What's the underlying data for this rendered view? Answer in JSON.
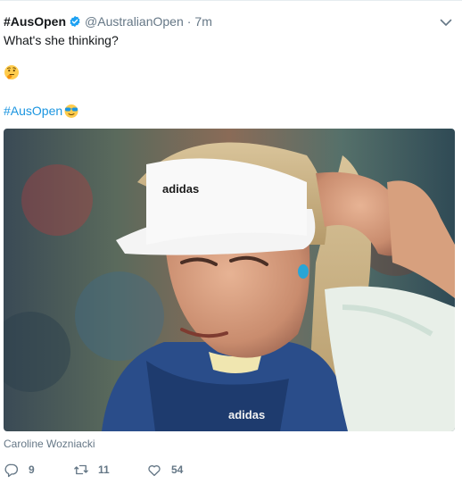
{
  "tweet": {
    "display_name": "#AusOpen",
    "handle": "@AustralianOpen",
    "separator": "·",
    "time": "7m",
    "text": "What's she thinking?",
    "hashtag": "#AusOpen",
    "media_caption": "Caroline Wozniacki",
    "counts": {
      "replies": "9",
      "retweets": "11",
      "likes": "54"
    },
    "icons": {
      "verified": "verified-badge-icon",
      "caret": "chevron-down-icon",
      "thinking": "thinking-face-emoji",
      "ao": "ausopen-sunglasses-emoji",
      "reply": "reply-icon",
      "retweet": "retweet-icon",
      "like": "heart-icon"
    },
    "photo_brand_text": "adidas",
    "colors": {
      "link": "#1b95e0",
      "muted": "#657786",
      "text": "#14171a",
      "verified": "#1da1f2"
    }
  }
}
